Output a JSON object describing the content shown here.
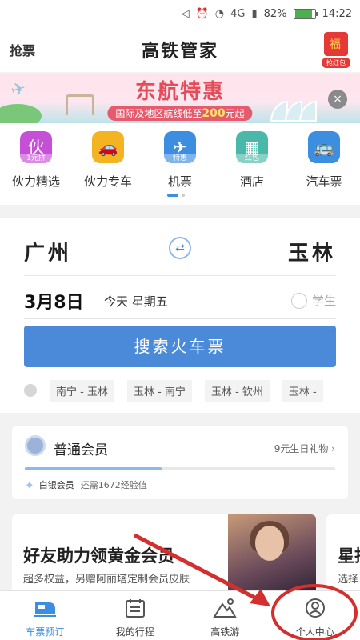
{
  "status_bar": {
    "battery": "82%",
    "time": "14:22",
    "battery_level": 0.82,
    "network": "4G"
  },
  "header": {
    "left_label": "抢票",
    "title": "高铁管家",
    "redpacket_label": "抢红包"
  },
  "banner": {
    "headline": "东航特惠",
    "sub_prefix": "国际及地区航线低至",
    "sub_amount": "200",
    "sub_suffix": "元起",
    "close": "×"
  },
  "quick_menu": [
    {
      "label": "伙力精选",
      "tag": "1元拼",
      "color": "#c64fd8",
      "icon": "shopping-bag-icon"
    },
    {
      "label": "伙力专车",
      "tag": "",
      "color": "#f4b422",
      "icon": "car-icon"
    },
    {
      "label": "机票",
      "tag": "特惠",
      "color": "#3b8ee0",
      "icon": "plane-icon"
    },
    {
      "label": "酒店",
      "tag": "红包",
      "color": "#49b8a9",
      "icon": "hotel-icon"
    },
    {
      "label": "汽车票",
      "tag": "",
      "color": "#3b8ee0",
      "icon": "bus-icon"
    }
  ],
  "search": {
    "from": "广州",
    "to": "玉林",
    "date": "3月8日",
    "day": "今天 星期五",
    "student": "学生",
    "button": "搜索火车票",
    "history": [
      "南宁 - 玉林",
      "玉林 - 南宁",
      "玉林 - 钦州",
      "玉林 -"
    ]
  },
  "member": {
    "title": "普通会员",
    "gift": "9元生日礼物",
    "level": "白银会员",
    "need": "还需1672经验值",
    "progress": 0.44
  },
  "promos": [
    {
      "title": "好友助力领黄金会员",
      "subtitle": "超多权益，另赠阿丽塔定制会员皮肤"
    },
    {
      "title": "星抖",
      "subtitle": "选择"
    }
  ],
  "tabs": [
    {
      "label": "车票预订",
      "icon": "train-icon",
      "active": true
    },
    {
      "label": "我的行程",
      "icon": "calendar-icon",
      "active": false
    },
    {
      "label": "高铁游",
      "icon": "mountain-icon",
      "active": false
    },
    {
      "label": "个人中心",
      "icon": "user-icon",
      "active": false
    }
  ],
  "colors": {
    "accent": "#3b8ee0",
    "button": "#4a8ad8",
    "annotation": "#d32f2f"
  }
}
